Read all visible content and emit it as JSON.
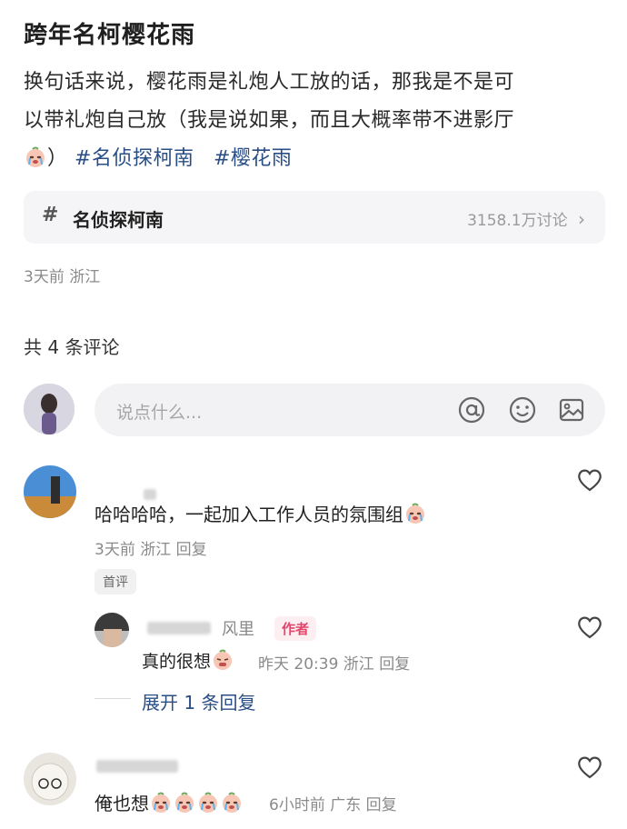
{
  "post": {
    "title": "跨年名柯樱花雨",
    "body_line1": "换句话来说，樱花雨是礼炮人工放的话，那我是不是可",
    "body_line2": "以带礼炮自己放（我是说如果，而且大概率带不进影厅",
    "body_line3_after_emoji": "）",
    "tags": [
      "#名侦探柯南",
      "#樱花雨"
    ],
    "topic_card": {
      "hash": "#",
      "name": "名侦探柯南",
      "count": "3158.1万讨论",
      "arrow": "›"
    },
    "meta": "3天前 浙江"
  },
  "comments_header": {
    "count_label": "共 4 条评论"
  },
  "input": {
    "placeholder": "说点什么..."
  },
  "comments": [
    {
      "text": "哈哈哈哈，一起加入工作人员的氛围组",
      "meta": "3天前 浙江 回复",
      "badge": "首评",
      "reply": {
        "name": "风里",
        "author_badge": "作者",
        "text": "真的很想",
        "meta": "昨天 20:39 浙江 回复"
      },
      "expand": "展开 1 条回复"
    },
    {
      "text": "俺也想",
      "meta": "6小时前 广东 回复"
    }
  ],
  "colors": {
    "accent": "#2a4e86",
    "author": "#e4456d"
  }
}
